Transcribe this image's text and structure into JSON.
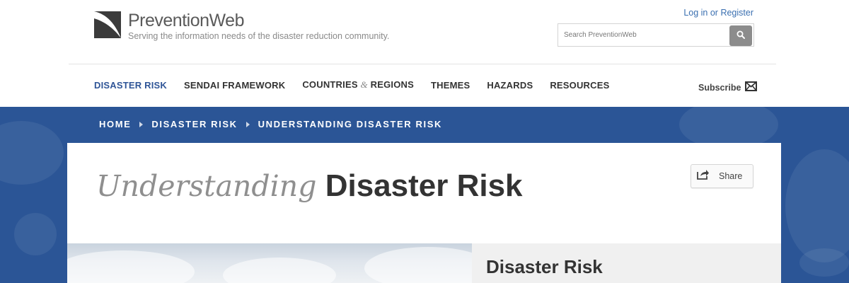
{
  "header": {
    "logo": {
      "name": "PreventionWeb",
      "tagline": "Serving the information needs of the disaster reduction community."
    },
    "login_link": "Log in or Register",
    "search": {
      "placeholder": "Search PreventionWeb",
      "button_icon": "search-icon"
    }
  },
  "nav": {
    "items": [
      {
        "label": "DISASTER RISK",
        "active": true
      },
      {
        "label": "SENDAI FRAMEWORK"
      },
      {
        "label_parts": [
          "COUNTRIES ",
          "&",
          " REGIONS"
        ]
      },
      {
        "label": "THEMES"
      },
      {
        "label": "HAZARDS"
      },
      {
        "label": "RESOURCES"
      }
    ],
    "subscribe_label": "Subscribe",
    "subscribe_icon": "envelope-icon"
  },
  "breadcrumb": [
    "HOME",
    "DISASTER RISK",
    "UNDERSTANDING DISASTER RISK"
  ],
  "page": {
    "title_em": "Understanding",
    "title_strong": "Disaster Risk",
    "share_label": "Share",
    "share_icon": "share-icon",
    "panel_title": "Disaster Risk"
  },
  "colors": {
    "brand_blue": "#2b5596",
    "nav_active": "#2f5597",
    "link": "#3a6fb0",
    "search_button": "#8c8c8c"
  }
}
